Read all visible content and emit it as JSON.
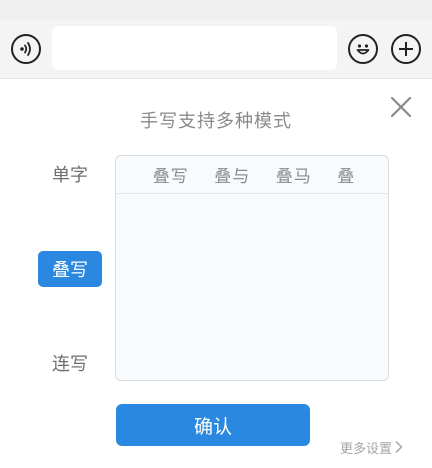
{
  "chat_bar": {
    "input_value": "",
    "icons": [
      "voice-icon",
      "emoji-icon",
      "plus-icon"
    ]
  },
  "handwriting_panel": {
    "title": "手写支持多种模式",
    "modes": [
      {
        "label": "单字",
        "selected": false
      },
      {
        "label": "叠写",
        "selected": true
      },
      {
        "label": "连写",
        "selected": false
      }
    ],
    "demo_chars": [
      "叠写",
      "叠与",
      "叠马",
      "叠"
    ],
    "confirm_label": "确认",
    "more_settings_label": "更多设置"
  },
  "colors": {
    "accent": "#2a88e0",
    "panel_background": "#ffffff",
    "canvas_background": "#f7fbfe",
    "muted_text": "#8a8a8a"
  }
}
